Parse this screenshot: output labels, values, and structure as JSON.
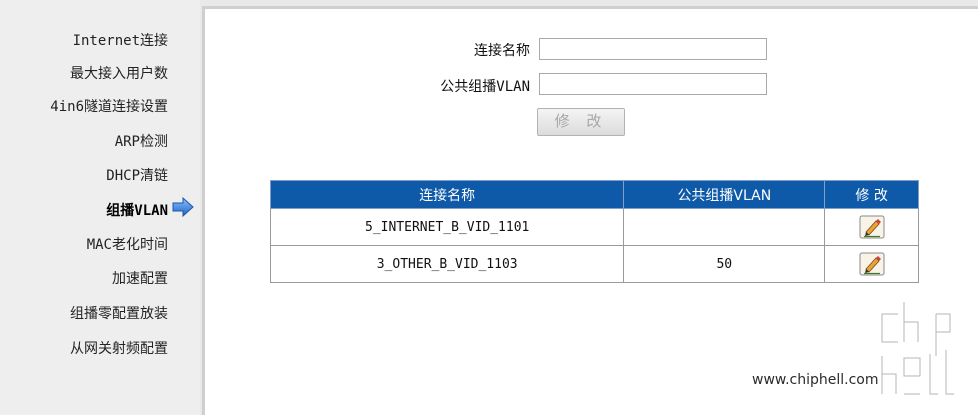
{
  "sidebar": {
    "items": [
      {
        "label": "Internet连接"
      },
      {
        "label": "最大接入用户数"
      },
      {
        "label": "4in6隧道连接设置"
      },
      {
        "label": "ARP检测"
      },
      {
        "label": "DHCP清链"
      },
      {
        "label": "组播VLAN",
        "active": true
      },
      {
        "label": "MAC老化时间"
      },
      {
        "label": "加速配置"
      },
      {
        "label": "组播零配置放装"
      },
      {
        "label": "从网关射频配置"
      }
    ]
  },
  "form": {
    "name_label": "连接名称",
    "name_value": "",
    "vlan_label": "公共组播VLAN",
    "vlan_value": "",
    "modify_button": "修 改"
  },
  "table": {
    "headers": [
      "连接名称",
      "公共组播VLAN",
      "修 改"
    ],
    "rows": [
      {
        "name": "5_INTERNET_B_VID_1101",
        "vlan": ""
      },
      {
        "name": "3_OTHER_B_VID_1103",
        "vlan": "50"
      }
    ]
  },
  "watermark": {
    "url": "www.chiphell.com",
    "logo_text": "chip hell"
  },
  "colors": {
    "table_header_bg": "#0f5aa8",
    "arrow": "#2e7bd6"
  },
  "icons": {
    "active_marker": "right-arrow-icon",
    "edit": "pencil-edit-icon"
  }
}
